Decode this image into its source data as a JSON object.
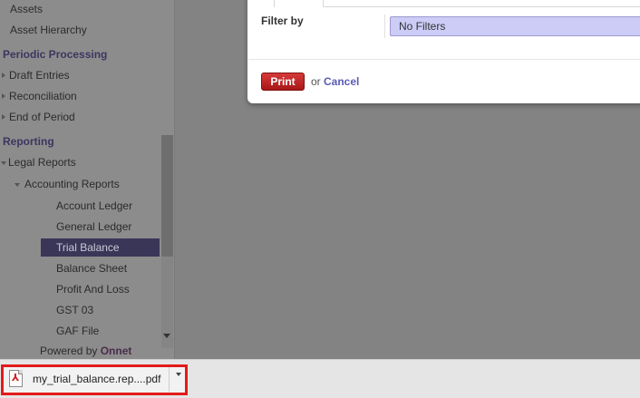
{
  "sidebar": {
    "items_top": [
      {
        "label": "Assets"
      },
      {
        "label": "Asset Hierarchy"
      }
    ],
    "periodic": {
      "title": "Periodic Processing",
      "items": [
        {
          "label": "Draft Entries"
        },
        {
          "label": "Reconciliation"
        },
        {
          "label": "End of Period"
        }
      ]
    },
    "reporting": {
      "title": "Reporting",
      "legal_reports": "Legal Reports",
      "accounting_reports": "Accounting Reports",
      "items": [
        {
          "label": "Account Ledger"
        },
        {
          "label": "General Ledger"
        },
        {
          "label": "Trial Balance"
        },
        {
          "label": "Balance Sheet"
        },
        {
          "label": "Profit And Loss"
        },
        {
          "label": "GST 03"
        },
        {
          "label": "GAF File"
        }
      ],
      "selected": "Trial Balance"
    },
    "powered_by": {
      "prefix": "Powered by",
      "brand": "Onnet"
    }
  },
  "dialog": {
    "filter_label": "Filter by",
    "filter_value": "No Filters",
    "print_label": "Print",
    "or_text": "or",
    "cancel_label": "Cancel"
  },
  "downloads": {
    "file_name": "my_trial_balance.rep....pdf",
    "icon": "pdf-file-icon"
  },
  "colors": {
    "print_button": "#c0262a",
    "highlight_box": "#e31b1b",
    "selected_item": "#3a3658",
    "filter_select": "#ccccf7"
  }
}
